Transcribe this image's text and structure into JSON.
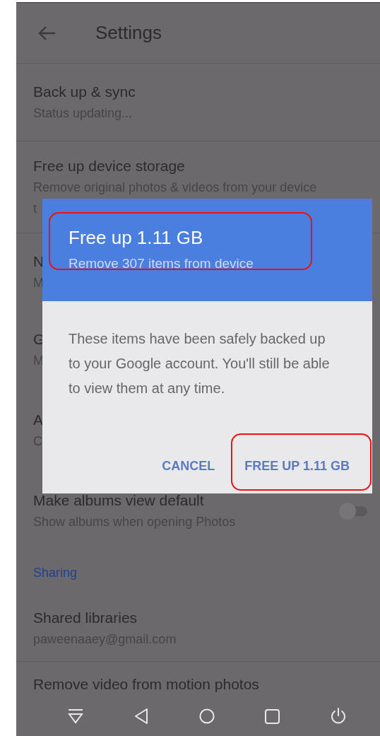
{
  "header": {
    "title": "Settings"
  },
  "settings": [
    {
      "kind": "item",
      "title": "Back up & sync",
      "subtitle_lines": [
        "Status updating..."
      ]
    },
    {
      "kind": "item",
      "title": "Free up device storage",
      "subtitle_lines": [
        "Remove original photos & videos from your device",
        "t"
      ]
    },
    {
      "kind": "item",
      "title": "N",
      "subtitle_lines": [
        "M"
      ]
    },
    {
      "kind": "item",
      "title": "G",
      "subtitle_lines": [
        "M"
      ]
    },
    {
      "kind": "item",
      "title": "A",
      "subtitle_lines": [
        "C"
      ]
    },
    {
      "kind": "toggle",
      "title": "Make albums view default",
      "subtitle_lines": [
        "Show albums when opening Photos"
      ],
      "on": false
    },
    {
      "kind": "section",
      "title": "Sharing"
    },
    {
      "kind": "item",
      "title": "Shared libraries",
      "subtitle_lines": [
        "paweenaaey@gmail.com"
      ]
    },
    {
      "kind": "cut",
      "title": "Remove video from motion photos"
    }
  ],
  "dialog": {
    "title": "Free up 1.11 GB",
    "subtitle": "Remove 307 items from device",
    "message": "These items have been safely backed up to your Google account. You'll still be able to view them at any time.",
    "buttons": [
      "CANCEL",
      "FREE UP 1.11 GB"
    ]
  }
}
